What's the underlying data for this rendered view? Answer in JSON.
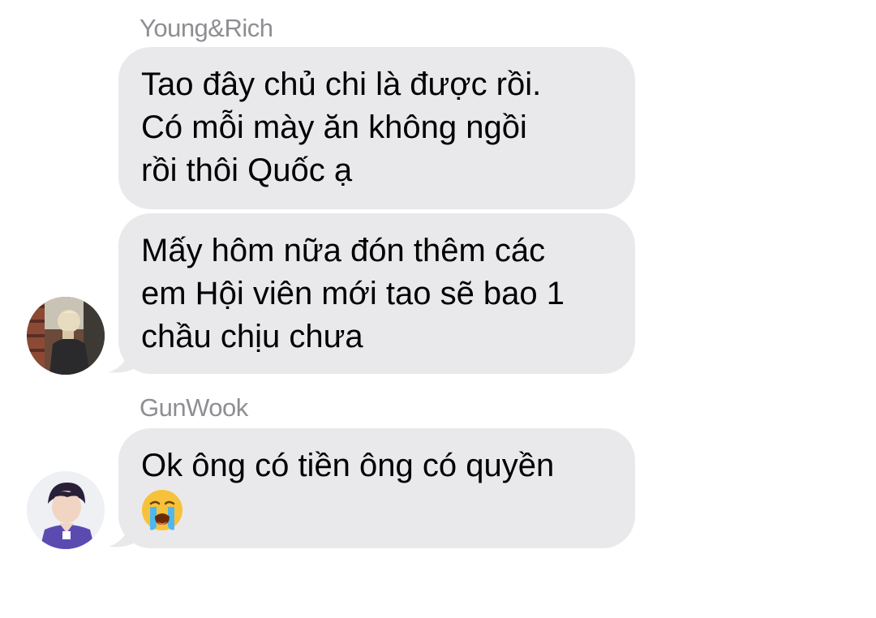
{
  "messages": [
    {
      "sender": "Young&Rich",
      "lines": [
        "Tao đây chủ chi là được rồi.",
        "Có mỗi mày ăn không ngồi",
        "rồi thôi Quốc ạ"
      ]
    },
    {
      "lines": [
        "Mấy hôm nữa đón thêm các",
        "em Hội viên mới tao sẽ bao 1",
        "chầu chịu chưa"
      ],
      "avatar": "avatar-young-rich"
    },
    {
      "sender": "GunWook",
      "lines": [
        "Ok ông có tiền ông có quyền"
      ],
      "emoji": "loudly-crying-face-emoji",
      "avatar": "avatar-gunwook"
    }
  ],
  "colors": {
    "bubble": "#e9e9eb",
    "sender": "#8e8e93",
    "text": "#000000",
    "background": "#ffffff"
  }
}
